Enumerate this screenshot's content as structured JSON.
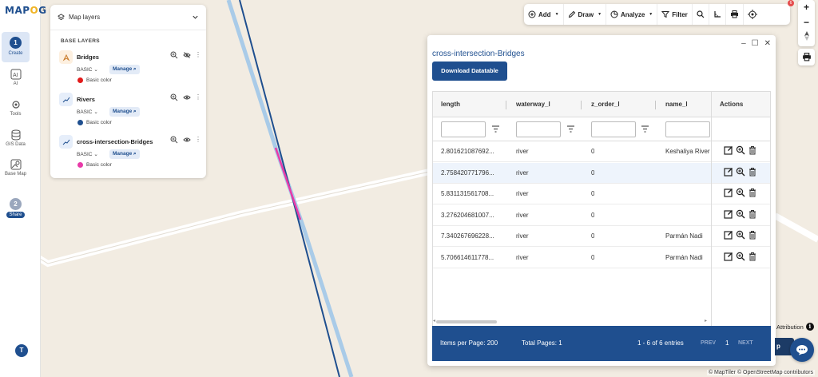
{
  "app": {
    "logo_left": "MAP",
    "logo_o": "O",
    "logo_right": "G"
  },
  "rail": {
    "items": [
      {
        "step": "1",
        "label": "Create"
      },
      {
        "label": "AI"
      },
      {
        "label": "Tools"
      },
      {
        "label": "GIS Data"
      },
      {
        "label": "Base Map"
      },
      {
        "step": "2",
        "label": "Share"
      }
    ],
    "avatar": "T"
  },
  "layers_panel": {
    "title": "Map layers",
    "section": "BASE LAYERS",
    "layers": [
      {
        "name": "Bridges",
        "style": "BASIC",
        "manage": "Manage",
        "color_label": "Basic color",
        "color": "#e21b1b"
      },
      {
        "name": "Rivers",
        "style": "BASIC",
        "manage": "Manage",
        "color_label": "Basic color",
        "color": "#1f4f8f"
      },
      {
        "name": "cross-intersection-Bridges",
        "style": "BASIC",
        "manage": "Manage",
        "color_label": "Basic color",
        "color": "#e83aa8"
      }
    ]
  },
  "toolbar": {
    "add": "Add",
    "draw": "Draw",
    "analyze": "Analyze",
    "filter": "Filter",
    "badge": "6"
  },
  "zoom": {
    "in": "+",
    "out": "−"
  },
  "datatable": {
    "title": "cross-intersection-Bridges",
    "download": "Download Datatable",
    "columns": [
      "length",
      "waterway_l",
      "z_order_l",
      "name_l",
      "Actions"
    ],
    "rows": [
      {
        "length": "2.801621087692...",
        "waterway": "river",
        "z_order": "0",
        "name": "Keshaliya River"
      },
      {
        "length": "2.758420771796...",
        "waterway": "river",
        "z_order": "0",
        "name": ""
      },
      {
        "length": "5.831131561708...",
        "waterway": "river",
        "z_order": "0",
        "name": ""
      },
      {
        "length": "3.276204681007...",
        "waterway": "river",
        "z_order": "0",
        "name": ""
      },
      {
        "length": "7.340267696228...",
        "waterway": "river",
        "z_order": "0",
        "name": "Parmán Nadi"
      },
      {
        "length": "5.706614611778...",
        "waterway": "river",
        "z_order": "0",
        "name": "Parmán Nadi"
      }
    ],
    "footer": {
      "items_per_page": "Items per Page: 200",
      "total_pages": "Total Pages: 1",
      "entries": "1 - 6 of 6 entries",
      "prev": "PREV",
      "page": "1",
      "next": "NEXT"
    }
  },
  "attribution": {
    "label": "Attribution",
    "info": "i",
    "credits": "© MapTiler © OpenStreetMap contributors"
  },
  "chip": "p"
}
